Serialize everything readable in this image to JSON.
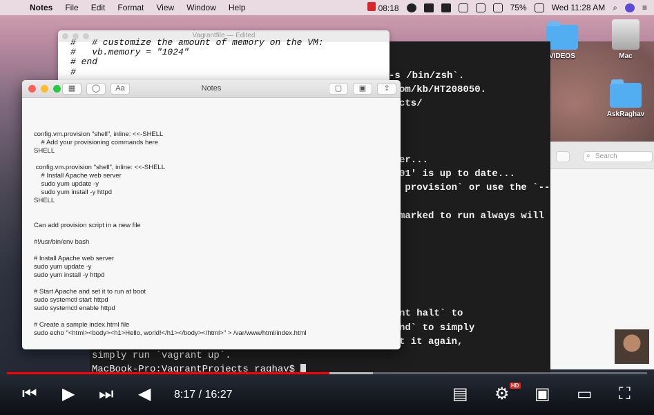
{
  "menubar": {
    "apple": "",
    "items": [
      "Notes",
      "File",
      "Edit",
      "Format",
      "View",
      "Window",
      "Help"
    ],
    "clock_badge": "08:18",
    "battery": "75%",
    "datetime": "Wed 11:28 AM",
    "icons": [
      "record-icon",
      "bolt-icon",
      "pen-icon",
      "shield-icon",
      "wifi-icon",
      "time-machine-icon",
      "volume-icon",
      "battery-icon",
      "search-icon",
      "user-icon",
      "list-icon"
    ]
  },
  "desktop": {
    "icons": [
      {
        "label": "VIDEOS",
        "type": "folder"
      },
      {
        "label": "Mac",
        "type": "drive"
      },
      {
        "label": "AskRaghav",
        "type": "folder"
      }
    ]
  },
  "textedit": {
    "title": "Vagrantfile — Edited",
    "lines": [
      "#   # customize the amount of memory on the VM:",
      "#   vb.memory = \"1024\"",
      "# end",
      "#"
    ]
  },
  "terminal": {
    "lines": [
      "-s /bin/zsh`.",
      "om/kb/HT208050.",
      "cts/",
      "er...",
      "01' is up to date...",
      " provision` or use the `--",
      "marked to run always will",
      "nt halt` to",
      "nd` to simply",
      "t it again,"
    ],
    "bottom_lines": [
      "simply run `vagrant up`.",
      "MacBook-Pro:VagrantProjects raghav$ "
    ]
  },
  "finder": {
    "search_placeholder": "Search"
  },
  "notes": {
    "title": "Notes",
    "toolbar": {
      "format_label": "Aa"
    },
    "lines": [
      "config.vm.provision \"shell\", inline: <<-SHELL",
      "    # Add your provisioning commands here",
      "SHELL",
      " config.vm.provision \"shell\", inline: <<-SHELL",
      "    # Install Apache web server",
      "    sudo yum update -y",
      "    sudo yum install -y httpd",
      "SHELL",
      "Can add provision script in a new file",
      "#!/usr/bin/env bash",
      "# Install Apache web server",
      "sudo yum update -y",
      "sudo yum install -y httpd",
      "# Start Apache and set it to run at boot",
      "sudo systemctl start httpd",
      "sudo systemctl enable httpd",
      "# Create a sample index.html file",
      "sudo echo \"<html><body><h1>Hello, world!</h1></body></html>\" > /var/www/html/index.html"
    ]
  },
  "player": {
    "time": "8:17 / 16:27",
    "progress": 0.504,
    "buffered": 0.572,
    "hd_badge": "HD",
    "accent": "#ff0000"
  }
}
